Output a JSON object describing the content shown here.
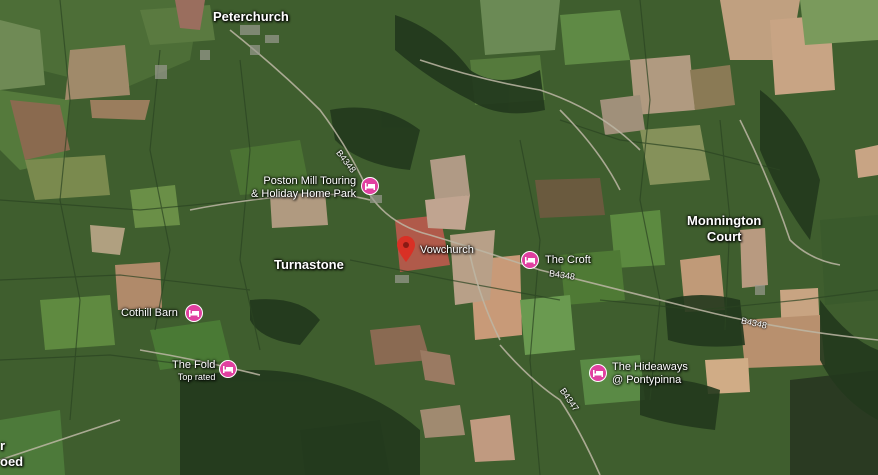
{
  "map": {
    "places": {
      "peterchurch": "Peterchurch",
      "turnastone": "Turnastone",
      "monnington_line1": "Monnington",
      "monnington_line2": "Court",
      "vowchurch": "Vowchurch"
    },
    "pois": {
      "poston_line1": "Poston Mill Touring",
      "poston_line2": "& Holiday Home Park",
      "the_croft": "The Croft",
      "cothill_barn": "Cothill Barn",
      "the_fold": "The Fold",
      "the_fold_badge": "Top rated",
      "hideaways_line1": "The Hideaways",
      "hideaways_line2": "@ Pontypinna"
    },
    "roads": {
      "b4348_a": "B4348",
      "b4348_b": "B4348",
      "b4348_c": "B4348",
      "b4347": "B4347"
    },
    "edge_labels": {
      "left_r": "r",
      "left_oed": "oed"
    },
    "colors": {
      "hotel_marker": "#e040a0",
      "location_pin": "#d93025",
      "label_text": "#ffffff"
    },
    "icons": {
      "hotel": "bed-icon",
      "pin": "location-pin-icon"
    }
  }
}
